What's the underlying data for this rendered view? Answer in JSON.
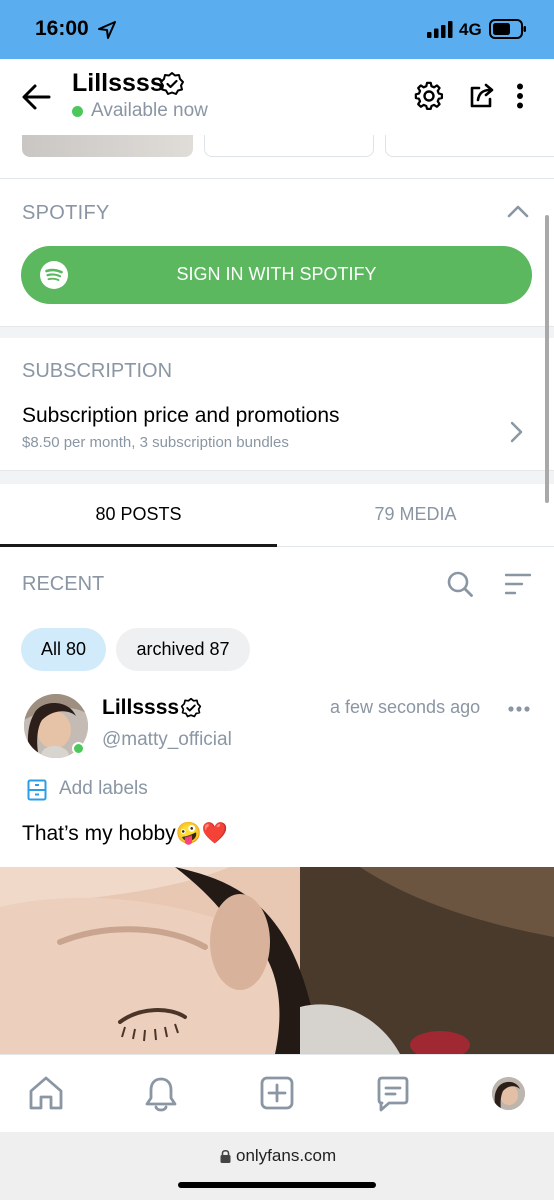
{
  "status_bar": {
    "time": "16:00",
    "network": "4G"
  },
  "header": {
    "name": "Lillssss",
    "status": "Available now"
  },
  "spotify": {
    "title": "SPOTIFY",
    "button_label": "SIGN IN WITH SPOTIFY"
  },
  "subscription": {
    "title": "SUBSCRIPTION",
    "main_label": "Subscription price and promotions",
    "detail": "$8.50 per month, 3 subscription bundles"
  },
  "tabs": [
    {
      "label": "80 POSTS",
      "active": true
    },
    {
      "label": "79 MEDIA",
      "active": false
    }
  ],
  "recent": {
    "title": "RECENT",
    "chips": [
      {
        "label": "All 80",
        "selected": true
      },
      {
        "label": "archived 87",
        "selected": false
      }
    ]
  },
  "post": {
    "author": "Lillssss",
    "handle": "@matty_official",
    "time": "a few seconds ago",
    "add_labels": "Add labels",
    "text": "That’s my hobby🤪❤️"
  },
  "bottom_nav": {
    "items": [
      "home-icon",
      "notifications-icon",
      "add-post-icon",
      "messages-icon",
      "profile-avatar"
    ]
  },
  "browser": {
    "url": "onlyfans.com"
  },
  "colors": {
    "status_bar": "#5aaef0",
    "spotify_green": "#5cb85f",
    "muted_text": "#8a96a3",
    "chip_selected": "#d1ebfb",
    "online": "#4cc85a"
  }
}
